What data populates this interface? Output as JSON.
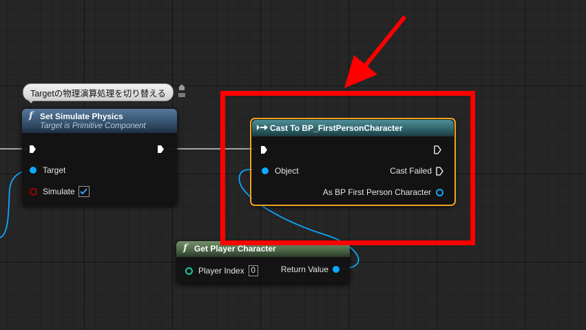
{
  "comment": {
    "text": "Targetの物理演算処理を切り替える"
  },
  "nodes": {
    "set_simulate_physics": {
      "title": "Set Simulate Physics",
      "subtitle": "Target is Primitive Component",
      "pins": {
        "target": "Target",
        "simulate": "Simulate"
      },
      "simulate_checked": true
    },
    "cast_to": {
      "title": "Cast To BP_FirstPersonCharacter",
      "pins": {
        "object": "Object",
        "cast_failed": "Cast Failed",
        "as_character": "As BP First Person Character"
      }
    },
    "get_player_character": {
      "title": "Get Player Character",
      "pins": {
        "player_index": "Player Index",
        "return_value": "Return Value"
      },
      "player_index_value": "0"
    }
  },
  "colors": {
    "object_pin": "#0fa8ff",
    "bool_pin": "#a10000",
    "int_pin": "#1ec9a4",
    "exec_pin": "#ffffff",
    "highlight": "#ff0000",
    "selection": "#f0a41e",
    "header_function": "#34506c",
    "header_cast": "#2d6068",
    "header_pure": "#4a6444"
  },
  "icons": {
    "function": "function-icon",
    "cast": "cast-icon",
    "pin": "pin-icon"
  }
}
